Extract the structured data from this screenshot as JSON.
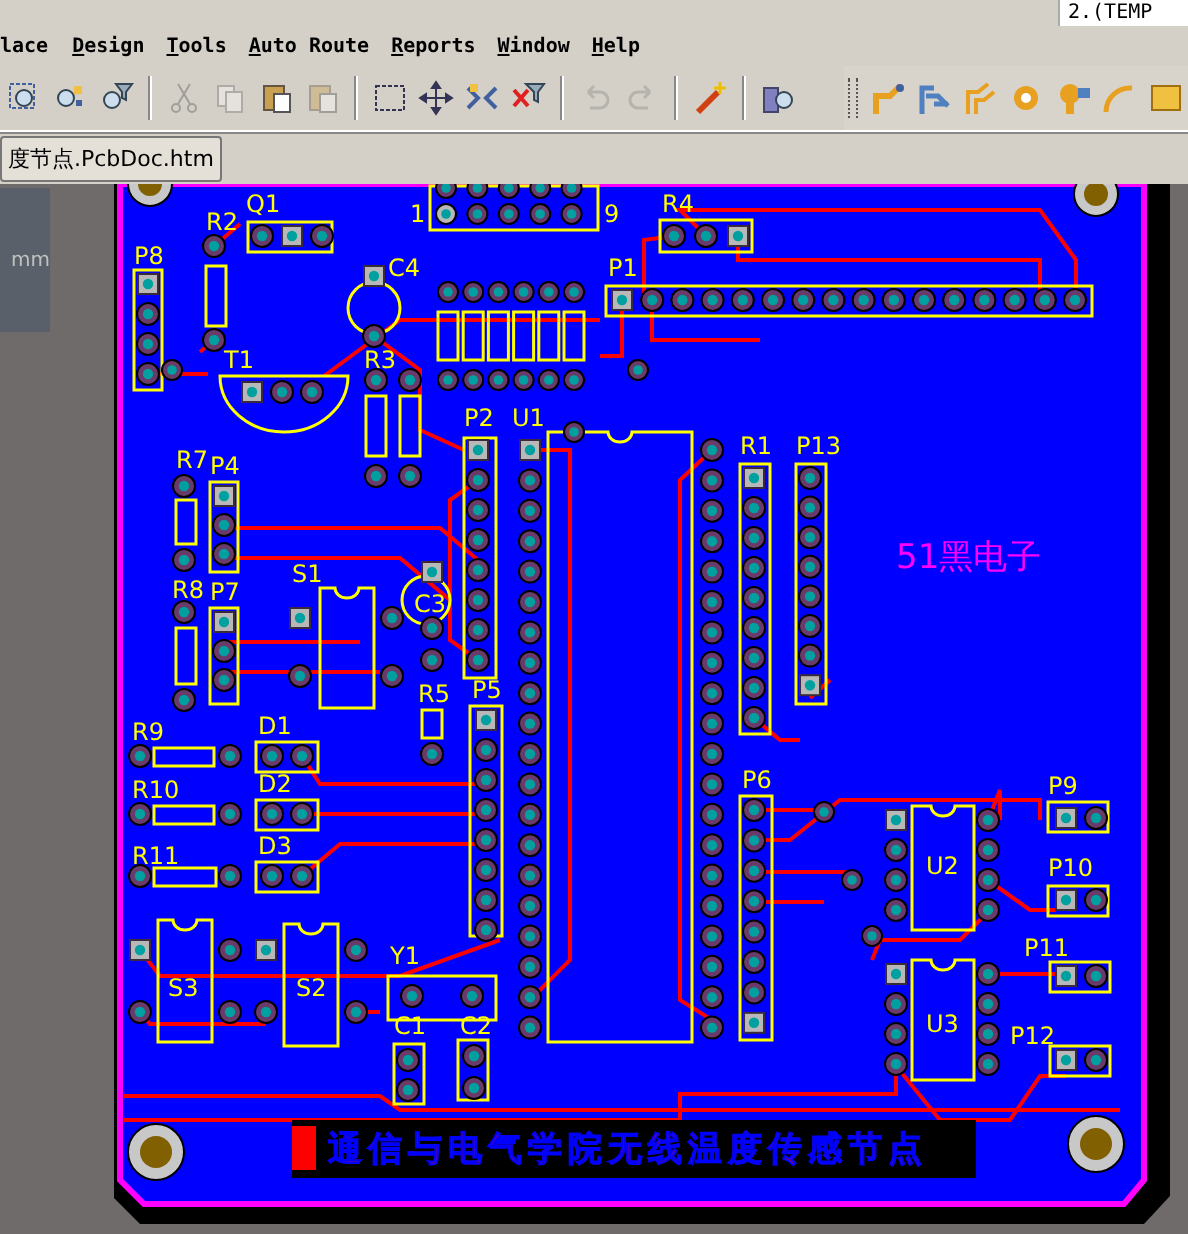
{
  "corner_text": "2.(TEMP",
  "menu": [
    {
      "label": "lace",
      "underlined_first": false
    },
    {
      "label": "Design",
      "underlined_first": true
    },
    {
      "label": "Tools",
      "underlined_first": true
    },
    {
      "label": "Auto Route",
      "underlined_first": true
    },
    {
      "label": "Reports",
      "underlined_first": true
    },
    {
      "label": "Window",
      "underlined_first": true
    },
    {
      "label": "Help",
      "underlined_first": true
    }
  ],
  "toolbars": [
    {
      "buttons": [
        {
          "disabled": false
        },
        {
          "disabled": false
        },
        {
          "disabled": false
        },
        {
          "disabled": true
        },
        {
          "disabled": true
        },
        {
          "disabled": false
        },
        {
          "disabled": true
        },
        {
          "disabled": false
        },
        {
          "disabled": false
        },
        {
          "disabled": false
        },
        {
          "disabled": false
        },
        {
          "disabled": true
        },
        {
          "disabled": true
        },
        {
          "disabled": false
        },
        {
          "disabled": false
        }
      ]
    },
    {
      "buttons": [
        {
          "disabled": false
        },
        {
          "disabled": false
        },
        {
          "disabled": false
        },
        {
          "disabled": false
        },
        {
          "disabled": false
        },
        {
          "disabled": false
        },
        {
          "disabled": false
        }
      ]
    }
  ],
  "document_tab": {
    "title": "度节点.PcbDoc.htm",
    "selected": true
  },
  "side_panel": {
    "unit": "mm"
  },
  "pcb": {
    "header_pin_labels": [
      "1",
      "9"
    ],
    "components": [
      {
        "designator": "R4"
      },
      {
        "designator": "Q1"
      },
      {
        "designator": "R2"
      },
      {
        "designator": "P8"
      },
      {
        "designator": "C4"
      },
      {
        "designator": "P1"
      },
      {
        "designator": "T1"
      },
      {
        "designator": "R3"
      },
      {
        "designator": "P2"
      },
      {
        "designator": "U1"
      },
      {
        "designator": "R1"
      },
      {
        "designator": "P13"
      },
      {
        "designator": "R7"
      },
      {
        "designator": "P4"
      },
      {
        "designator": "R8"
      },
      {
        "designator": "P7"
      },
      {
        "designator": "S1"
      },
      {
        "designator": "C3"
      },
      {
        "designator": "R5"
      },
      {
        "designator": "P5"
      },
      {
        "designator": "R9"
      },
      {
        "designator": "D1"
      },
      {
        "designator": "R10"
      },
      {
        "designator": "D2"
      },
      {
        "designator": "R11"
      },
      {
        "designator": "D3"
      },
      {
        "designator": "S3"
      },
      {
        "designator": "S2"
      },
      {
        "designator": "Y1"
      },
      {
        "designator": "C1"
      },
      {
        "designator": "C2"
      },
      {
        "designator": "P6"
      },
      {
        "designator": "U2"
      },
      {
        "designator": "U3"
      },
      {
        "designator": "P9"
      },
      {
        "designator": "P10"
      },
      {
        "designator": "P11"
      },
      {
        "designator": "P12"
      }
    ],
    "logo_text": "51黑电子",
    "title_text": "通信与电气学院无线温度传感节点"
  }
}
